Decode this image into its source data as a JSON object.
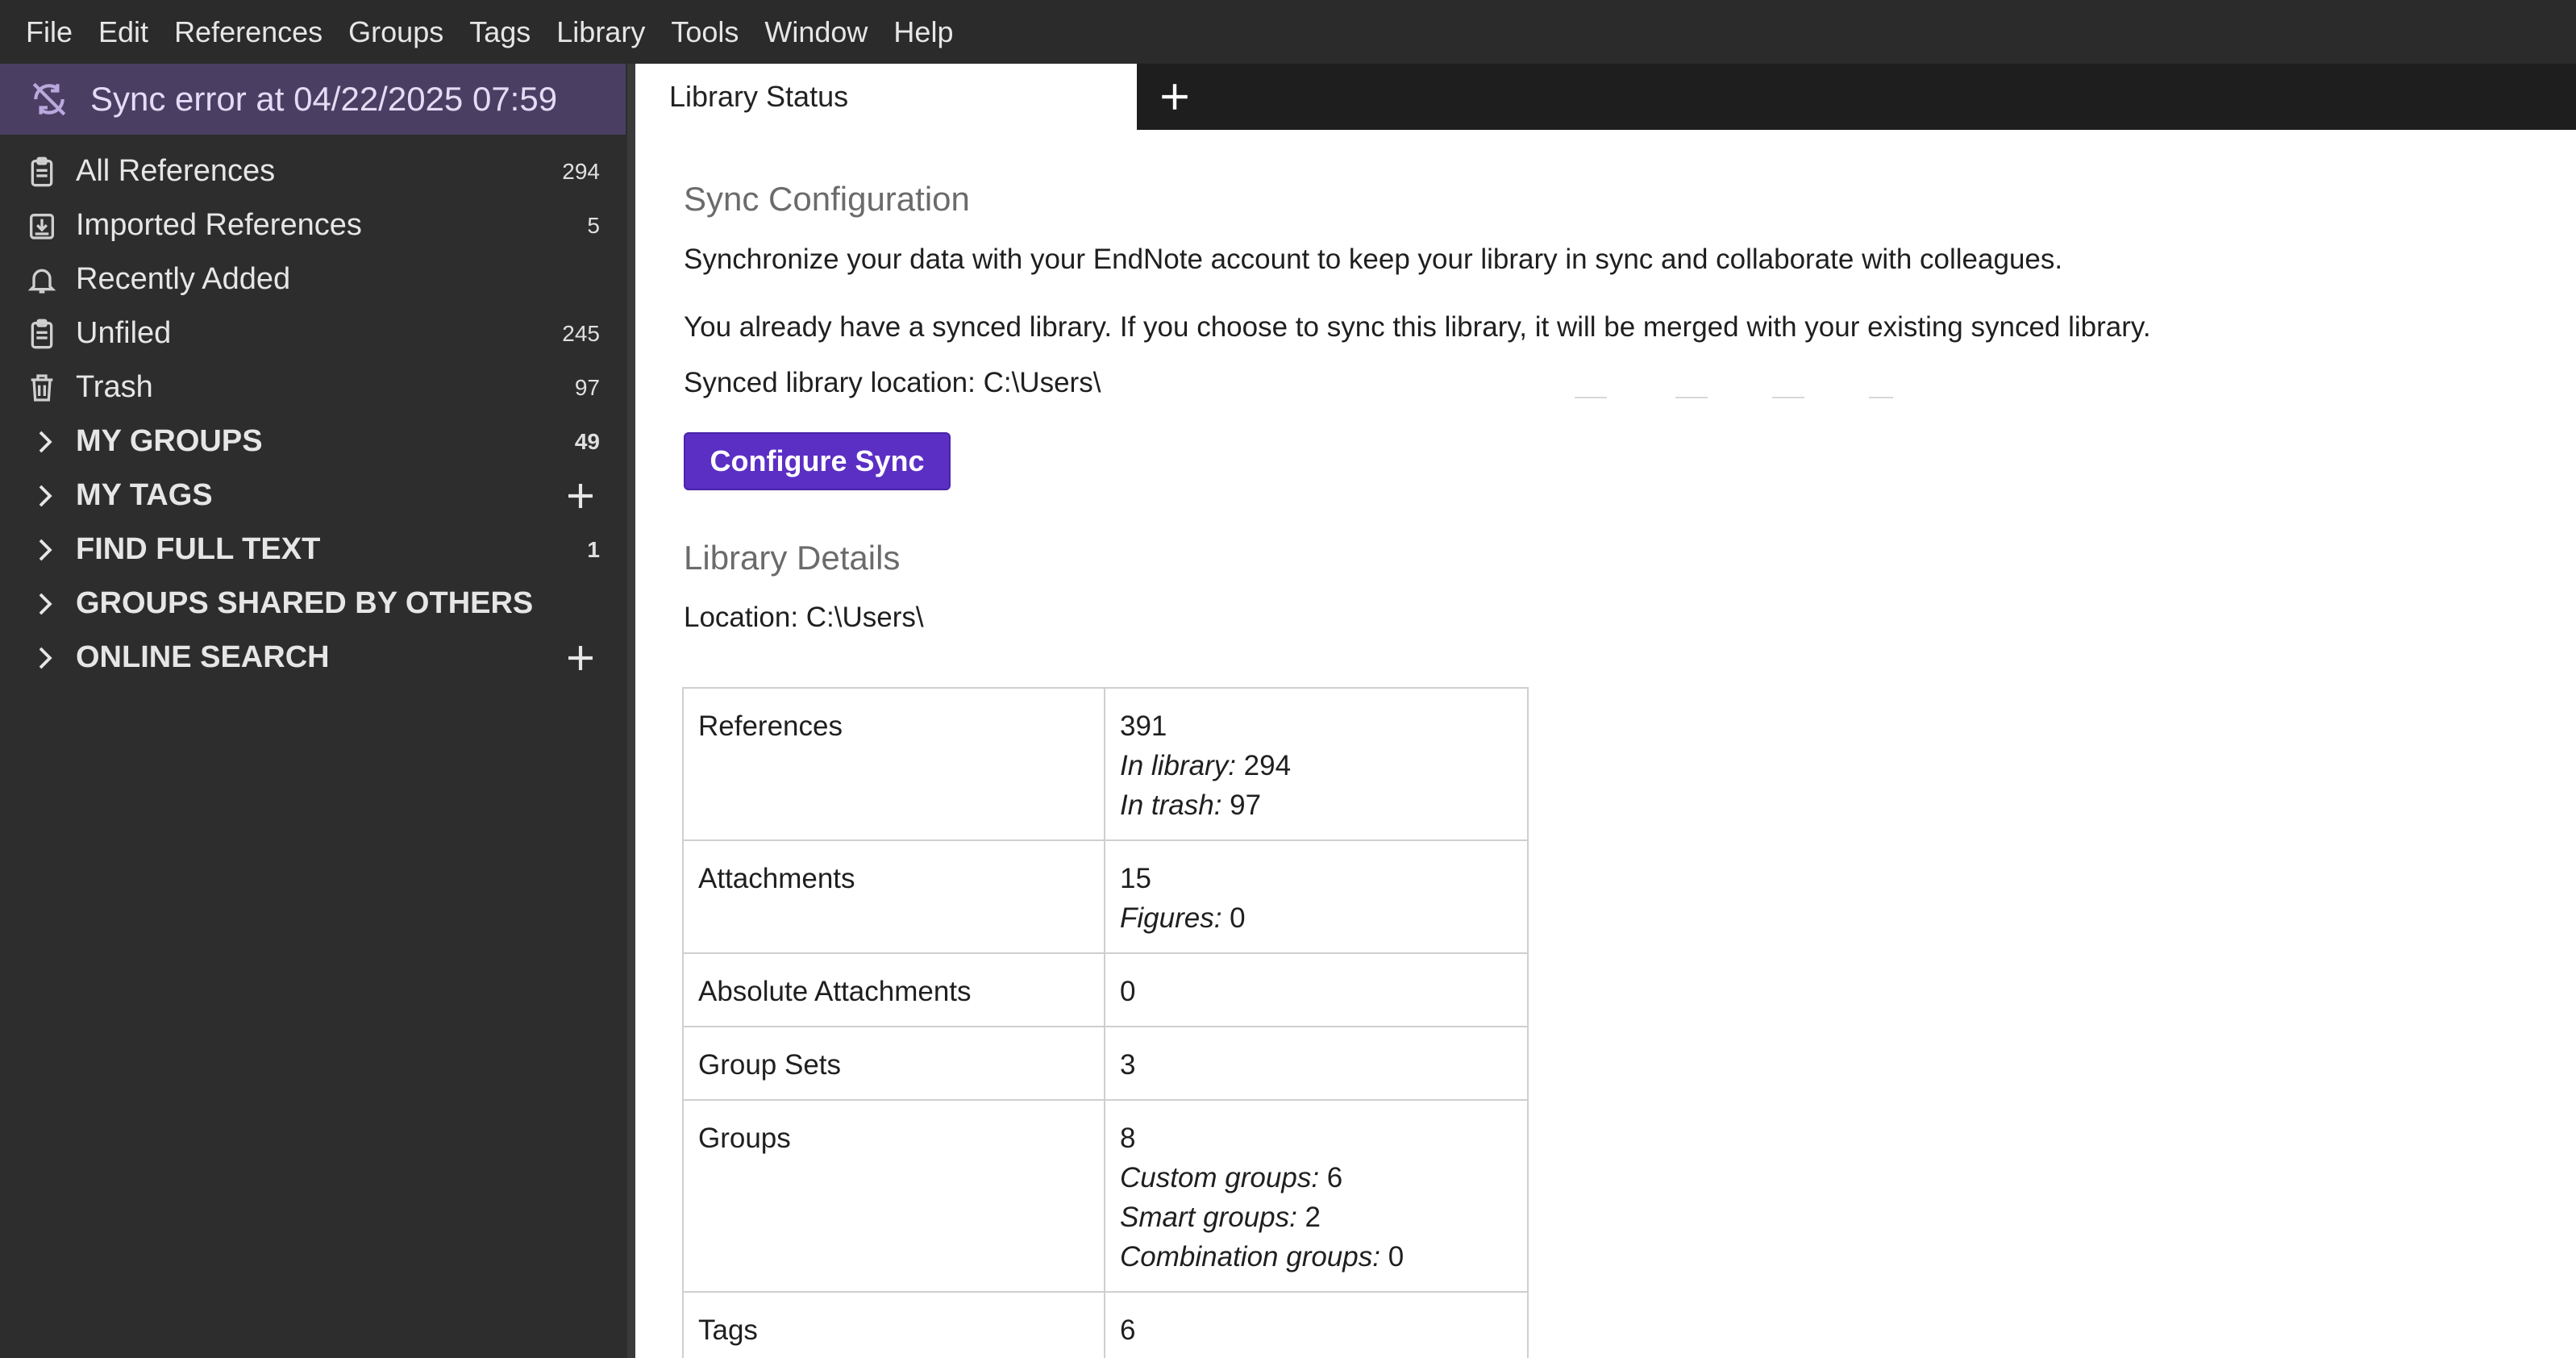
{
  "menubar": {
    "items": [
      "File",
      "Edit",
      "References",
      "Groups",
      "Tags",
      "Library",
      "Tools",
      "Window",
      "Help"
    ]
  },
  "sidebar": {
    "sync_error": "Sync error at 04/22/2025 07:59",
    "items": [
      {
        "label": "All References",
        "count": "294",
        "icon": "clipboard-icon"
      },
      {
        "label": "Imported References",
        "count": "5",
        "icon": "import-icon"
      },
      {
        "label": "Recently Added",
        "count": "",
        "icon": "bell-icon"
      },
      {
        "label": "Unfiled",
        "count": "245",
        "icon": "clipboard-icon"
      },
      {
        "label": "Trash",
        "count": "97",
        "icon": "trash-icon"
      }
    ],
    "sections": [
      {
        "label": "MY GROUPS",
        "count": "49"
      },
      {
        "label": "MY TAGS",
        "count": ""
      },
      {
        "label": "FIND FULL TEXT",
        "count": "1"
      },
      {
        "label": "GROUPS SHARED BY OTHERS",
        "count": ""
      },
      {
        "label": "ONLINE SEARCH",
        "count": ""
      }
    ]
  },
  "tabs": {
    "active_label": "Library Status"
  },
  "sync_config": {
    "heading": "Sync Configuration",
    "description": "Synchronize your data with your EndNote account to keep your library in sync and collaborate with colleagues.",
    "notice": "You already have a synced library. If you choose to sync this library, it will be merged with your existing synced library.",
    "location": "Synced library location: C:\\Users\\",
    "button": "Configure Sync"
  },
  "library_details": {
    "heading": "Library Details",
    "location": "Location: C:\\Users\\",
    "rows": [
      {
        "key": "References",
        "value": "391",
        "subs": [
          {
            "label": "In library:",
            "value": " 294"
          },
          {
            "label": "In trash:",
            "value": " 97"
          }
        ]
      },
      {
        "key": "Attachments",
        "value": "15",
        "subs": [
          {
            "label": "Figures:",
            "value": " 0"
          }
        ]
      },
      {
        "key": "Absolute Attachments",
        "value": "0",
        "subs": []
      },
      {
        "key": "Group Sets",
        "value": "3",
        "subs": []
      },
      {
        "key": "Groups",
        "value": "8",
        "subs": [
          {
            "label": "Custom groups:",
            "value": " 6"
          },
          {
            "label": "Smart groups:",
            "value": " 2"
          },
          {
            "label": "Combination groups:",
            "value": " 0"
          }
        ]
      },
      {
        "key": "Tags",
        "value": "6",
        "subs": []
      }
    ]
  },
  "colors": {
    "accent": "#5b2fc4",
    "sync_error_bg": "#4a3f63"
  }
}
